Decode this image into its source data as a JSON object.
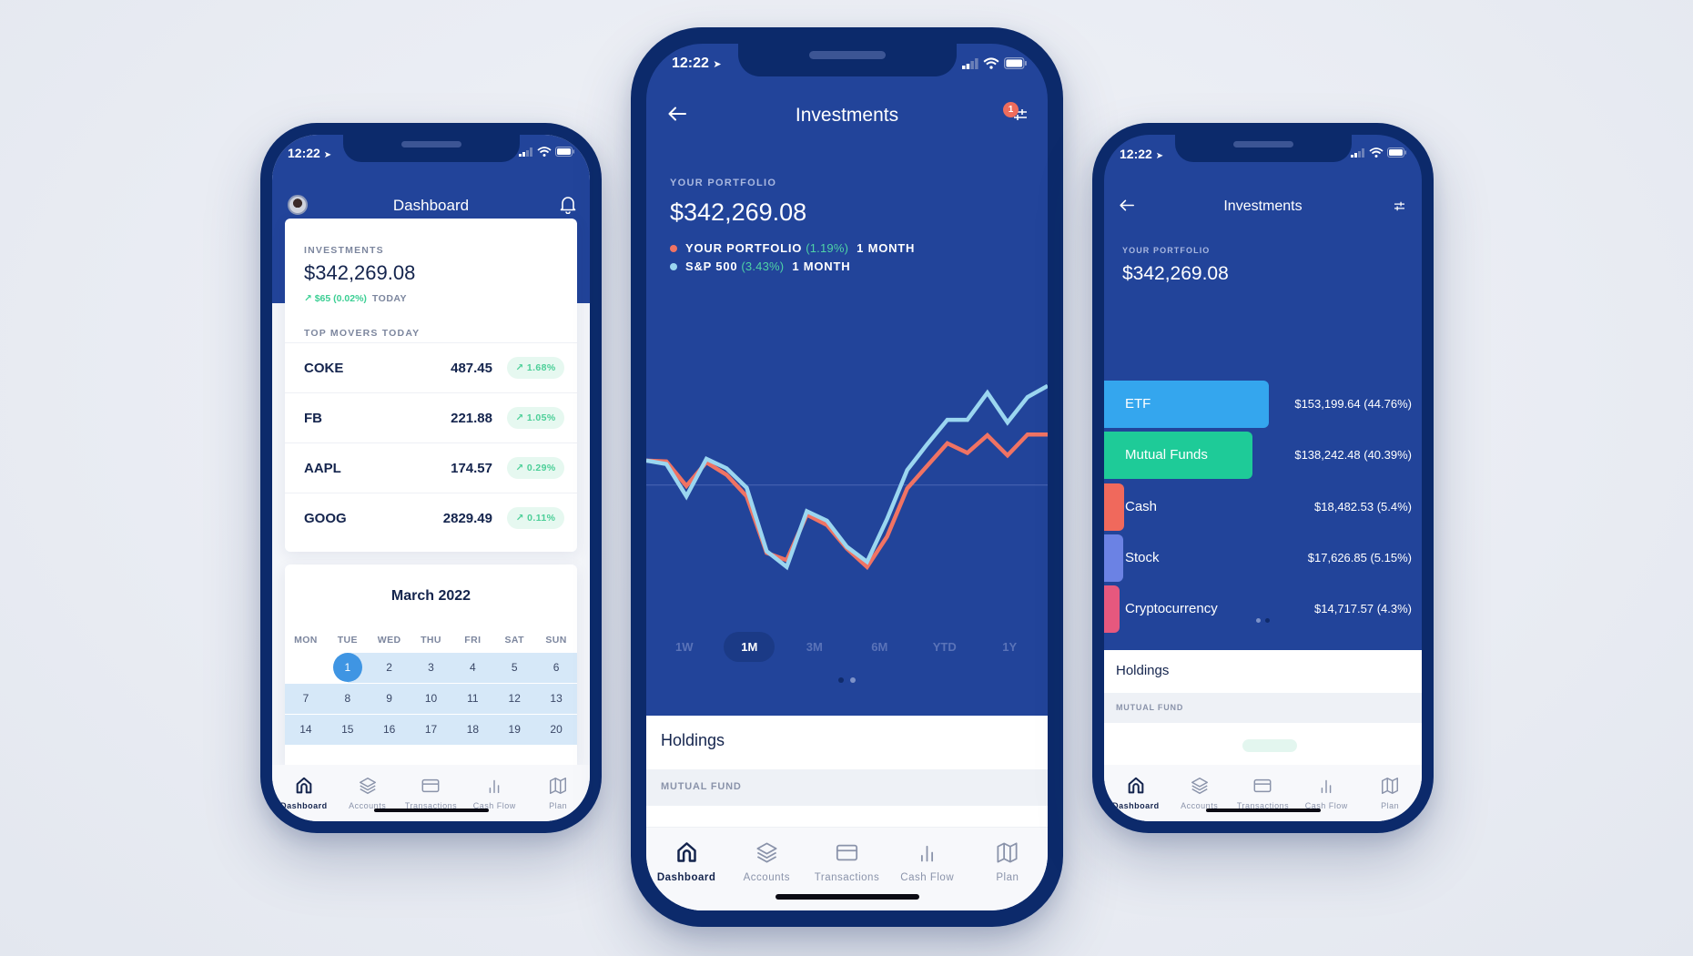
{
  "status_bar": {
    "time": "12:22"
  },
  "tabbar": {
    "items": [
      {
        "label": "Dashboard",
        "icon": "home-icon",
        "active": true
      },
      {
        "label": "Accounts",
        "icon": "layers-icon",
        "active": false
      },
      {
        "label": "Transactions",
        "icon": "credit-card-icon",
        "active": false
      },
      {
        "label": "Cash Flow",
        "icon": "bar-chart-icon",
        "active": false
      },
      {
        "label": "Plan",
        "icon": "map-icon",
        "active": false
      }
    ]
  },
  "dashboard": {
    "title": "Dashboard",
    "investments": {
      "label": "INVESTMENTS",
      "amount": "$342,269.08",
      "delta": "↗ $65 (0.02%)",
      "delta_period": "TODAY"
    },
    "top_movers": {
      "label": "TOP MOVERS TODAY",
      "rows": [
        {
          "symbol": "COKE",
          "price": "487.45",
          "change": "↗ 1.68%"
        },
        {
          "symbol": "FB",
          "price": "221.88",
          "change": "↗ 1.05%"
        },
        {
          "symbol": "AAPL",
          "price": "174.57",
          "change": "↗ 0.29%"
        },
        {
          "symbol": "GOOG",
          "price": "2829.49",
          "change": "↗ 0.11%"
        }
      ]
    },
    "calendar": {
      "month": "March 2022",
      "weekdays": [
        "MON",
        "TUE",
        "WED",
        "THU",
        "FRI",
        "SAT",
        "SUN"
      ],
      "weeks": [
        [
          "",
          "1",
          "2",
          "3",
          "4",
          "5",
          "6"
        ],
        [
          "7",
          "8",
          "9",
          "10",
          "11",
          "12",
          "13"
        ],
        [
          "14",
          "15",
          "16",
          "17",
          "18",
          "19",
          "20"
        ]
      ],
      "selected_day": "1"
    }
  },
  "investments": {
    "title": "Investments",
    "filter_badge": "1",
    "portfolio_label": "YOUR PORTFOLIO",
    "portfolio_amount": "$342,269.08",
    "legend": [
      {
        "name": "YOUR PORTFOLIO",
        "pct": "(1.19%)",
        "period": "1 MONTH",
        "color": "#f07363"
      },
      {
        "name": "S&P 500",
        "pct": "(3.43%)",
        "period": "1 MONTH",
        "color": "#9bd6f0"
      }
    ],
    "ranges": [
      {
        "label": "1W",
        "active": false
      },
      {
        "label": "1M",
        "active": true
      },
      {
        "label": "3M",
        "active": false
      },
      {
        "label": "6M",
        "active": false
      },
      {
        "label": "YTD",
        "active": false
      },
      {
        "label": "1Y",
        "active": false
      }
    ],
    "holdings_title": "Holdings",
    "holdings_section": "MUTUAL FUND",
    "allocation": [
      {
        "name": "ETF",
        "value": "$153,199.64 (44.76%)",
        "pct": 44.76,
        "color": "#34a6ee"
      },
      {
        "name": "Mutual Funds",
        "value": "$138,242.48 (40.39%)",
        "pct": 40.39,
        "color": "#1ecb98"
      },
      {
        "name": "Cash",
        "value": "$18,482.53 (5.4%)",
        "pct": 5.4,
        "color": "#f0695c"
      },
      {
        "name": "Stock",
        "value": "$17,626.85 (5.15%)",
        "pct": 5.15,
        "color": "#6b82e4"
      },
      {
        "name": "Cryptocurrency",
        "value": "$14,717.57 (4.3%)",
        "pct": 4.3,
        "color": "#e6587e"
      }
    ]
  },
  "chart_data": {
    "type": "line",
    "title": "",
    "xlabel": "",
    "ylabel": "",
    "x": [
      1,
      2,
      3,
      4,
      5,
      6,
      7,
      8,
      9,
      10,
      11,
      12,
      13,
      14,
      15,
      16,
      17,
      18,
      19,
      20,
      21
    ],
    "ylim": [
      -4.6,
      4.9
    ],
    "baseline": 0,
    "grid": false,
    "series": [
      {
        "name": "YOUR PORTFOLIO",
        "color": "#f07363",
        "values": [
          0.85,
          0.82,
          -0.03,
          0.79,
          0.36,
          -0.39,
          -2.36,
          -2.61,
          -1.03,
          -1.39,
          -2.21,
          -2.85,
          -1.79,
          -0.12,
          0.67,
          1.45,
          1.12,
          1.73,
          1.03,
          1.76,
          1.76
        ]
      },
      {
        "name": "S&P 500",
        "color": "#9bd6f0",
        "values": [
          0.85,
          0.73,
          -0.39,
          0.91,
          0.58,
          -0.09,
          -2.3,
          -2.85,
          -0.91,
          -1.24,
          -2.15,
          -2.67,
          -1.18,
          0.52,
          1.42,
          2.27,
          2.27,
          3.21,
          2.18,
          3.06,
          3.45
        ]
      }
    ]
  }
}
